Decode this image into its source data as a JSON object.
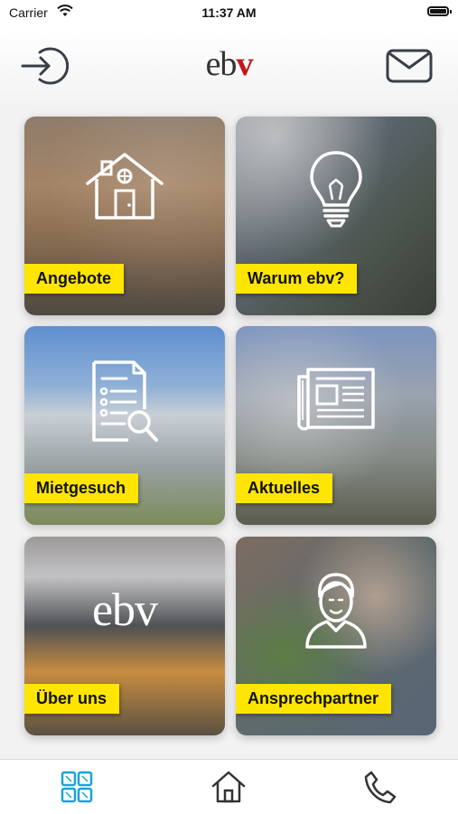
{
  "status_bar": {
    "carrier": "Carrier",
    "time": "11:37 AM"
  },
  "header": {
    "logo_text": "eb",
    "logo_mark": "v",
    "logo_mark_color": "#c4161c",
    "left_icon": "login-icon",
    "right_icon": "mail-icon"
  },
  "tiles": [
    {
      "label": "Angebote",
      "icon": "house-icon"
    },
    {
      "label": "Warum ebv?",
      "icon": "lightbulb-icon"
    },
    {
      "label": "Mietgesuch",
      "icon": "document-search-icon"
    },
    {
      "label": "Aktuelles",
      "icon": "newspaper-icon"
    },
    {
      "label": "Über uns",
      "icon": "ebv-logo",
      "logo_text": "ebv"
    },
    {
      "label": "Ansprechpartner",
      "icon": "person-icon"
    }
  ],
  "tabbar": {
    "items": [
      {
        "name": "grid",
        "icon": "grid-icon",
        "active": true
      },
      {
        "name": "home",
        "icon": "home-icon",
        "active": false
      },
      {
        "name": "phone",
        "icon": "phone-icon",
        "active": false
      }
    ],
    "active_color": "#1aa3d8",
    "inactive_color": "#333333"
  },
  "colors": {
    "label_background": "#ffe500",
    "background": "#f2f2f3"
  }
}
